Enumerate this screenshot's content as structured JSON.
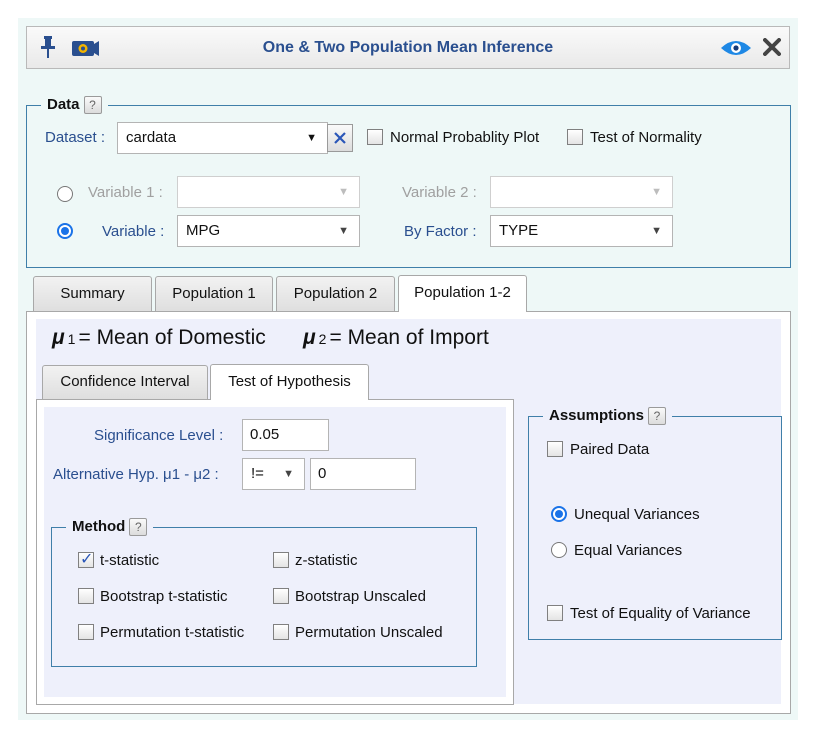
{
  "window": {
    "title": "One & Two Population Mean Inference",
    "pin_icon": "pin-icon",
    "camera_icon": "camera-icon",
    "eye_icon": "eye-icon",
    "close_icon": "close-icon"
  },
  "data_group": {
    "legend": "Data",
    "help": "?",
    "dataset_label": "Dataset :",
    "dataset_value": "cardata",
    "normal_plot_label": "Normal Probablity Plot",
    "normality_test_label": "Test of Normality",
    "variable1_label": "Variable 1 :",
    "variable2_label": "Variable 2 :",
    "variable_label": "Variable :",
    "variable_value": "MPG",
    "by_factor_label": "By Factor :",
    "by_factor_value": "TYPE"
  },
  "tabs": [
    "Summary",
    "Population 1",
    "Population 2",
    "Population 1-2"
  ],
  "population_labels": {
    "mu1_symbol": "μ",
    "mu1_sub": "1",
    "mu1_text": "= Mean of Domestic",
    "mu2_symbol": "μ",
    "mu2_sub": "2",
    "mu2_text": "= Mean of Import"
  },
  "subtabs": [
    "Confidence Interval",
    "Test of Hypothesis"
  ],
  "hypothesis": {
    "sig_label": "Significance Level :",
    "sig_value": "0.05",
    "alt_label": "Alternative Hyp. μ1 - μ2 :",
    "alt_operator": "!=",
    "alt_value": "0"
  },
  "method": {
    "legend": "Method",
    "help": "?",
    "t_stat": "t-statistic",
    "z_stat": "z-statistic",
    "boot_t": "Bootstrap t-statistic",
    "boot_unscaled": "Bootstrap Unscaled",
    "perm_t": "Permutation t-statistic",
    "perm_unscaled": "Permutation Unscaled"
  },
  "assumptions": {
    "legend": "Assumptions",
    "help": "?",
    "paired": "Paired Data",
    "unequal": "Unequal Variances",
    "equal": "Equal Variances",
    "equality_test": "Test of Equality of Variance"
  },
  "colors": {
    "accent": "#1a73e8",
    "title": "#2a4f8f",
    "border": "#3f7fa9"
  }
}
